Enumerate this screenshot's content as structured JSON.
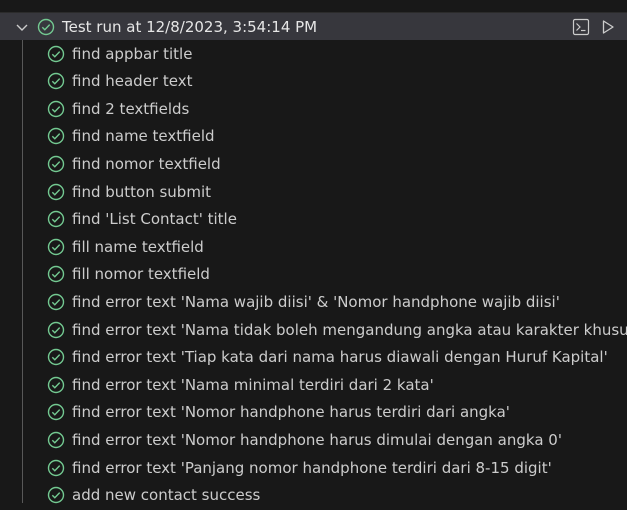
{
  "run": {
    "title": "Test run at 12/8/2023, 3:54:14 PM",
    "status": "passed"
  },
  "icons": {
    "expand": "chevron-down-icon",
    "status": "check-circle-icon",
    "terminal": "terminal-icon",
    "run": "play-icon"
  },
  "colors": {
    "passed": "#73c991",
    "header_bg": "#37373d",
    "background": "#181818"
  },
  "tests": [
    {
      "label": "find appbar title"
    },
    {
      "label": "find header text"
    },
    {
      "label": "find 2 textfields"
    },
    {
      "label": "find name textfield"
    },
    {
      "label": "find nomor textfield"
    },
    {
      "label": "find button submit"
    },
    {
      "label": "find 'List Contact' title"
    },
    {
      "label": "fill name textfield"
    },
    {
      "label": "fill nomor textfield"
    },
    {
      "label": "find error text 'Nama wajib diisi' & 'Nomor handphone wajib diisi'"
    },
    {
      "label": "find error text 'Nama tidak boleh mengandung angka atau karakter khusus'"
    },
    {
      "label": "find error text 'Tiap kata dari nama harus diawali dengan Huruf Kapital'"
    },
    {
      "label": "find error text 'Nama minimal terdiri dari 2 kata'"
    },
    {
      "label": "find error text 'Nomor handphone harus terdiri dari angka'"
    },
    {
      "label": "find error text 'Nomor handphone harus dimulai dengan angka 0'"
    },
    {
      "label": "find error text 'Panjang nomor handphone terdiri dari 8-15 digit'"
    },
    {
      "label": "add new contact success"
    }
  ]
}
